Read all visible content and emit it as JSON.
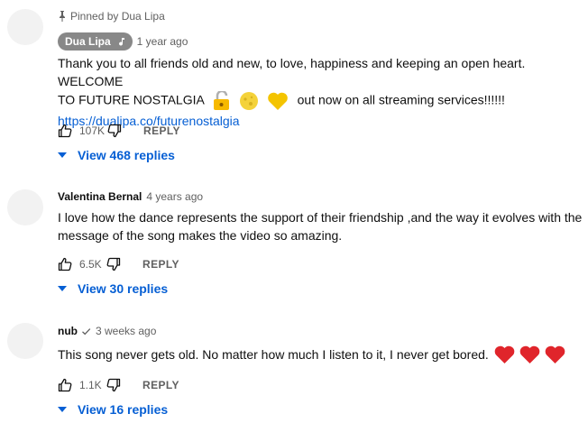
{
  "comments": [
    {
      "pinned_label": "Pinned by Dua Lipa",
      "author": "Dua Lipa",
      "time": "1 year ago",
      "text_line1": "Thank you to all friends old and new, to love, happiness and keeping an open heart. WELCOME",
      "text_line2_a": "TO FUTURE NOSTALGIA",
      "text_line2_b": "out now on all streaming services!!!!!!",
      "link": "https://dualipa.co/futurenostalgia",
      "likes": "107K",
      "reply_label": "REPLY",
      "view_replies": "View 468 replies"
    },
    {
      "author": "Valentina Bernal",
      "time": "4 years ago",
      "text_line1": "I love how the dance represents the support of their friendship ,and the way it evolves with the",
      "text_line2": "message of the song makes the video so amazing.",
      "likes": "6.5K",
      "reply_label": "REPLY",
      "view_replies": "View 30 replies"
    },
    {
      "author": "nub",
      "time": "3 weeks ago",
      "text_line1": "This song never gets old. No matter how much I listen to it, I never get bored.",
      "likes": "1.1K",
      "reply_label": "REPLY",
      "view_replies": "View 16 replies"
    }
  ],
  "colors": {
    "link": "#065fd4",
    "secondary_text": "#606060",
    "chip_bg": "#888888",
    "heart": "#e0252b"
  },
  "icons": [
    "pin-icon",
    "music-note-icon",
    "verified-check-icon",
    "thumbs-up-icon",
    "thumbs-down-icon",
    "caret-down-icon",
    "lock-emoji",
    "moon-emoji",
    "yellow-heart-emoji",
    "red-heart-emoji"
  ]
}
